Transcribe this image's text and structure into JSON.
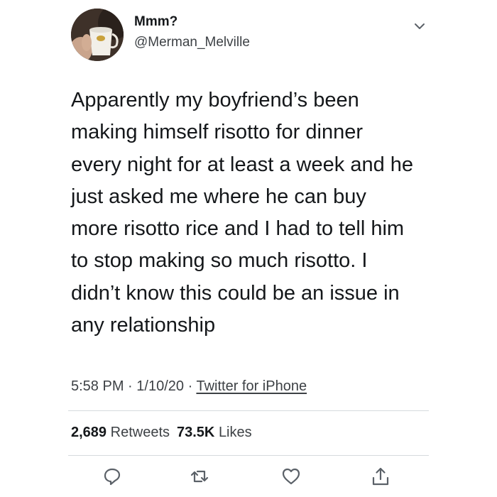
{
  "author": {
    "display_name": "Mmm?",
    "handle": "@Merman_Melville"
  },
  "tweet": {
    "text_lines": [
      "Apparently my boyfriend’s been",
      "making himself risotto for dinner",
      "every night for at least a week and he",
      "just asked me where he can buy",
      "more risotto rice and I had to tell him",
      "to stop making so much risotto. I",
      "didn’t know this could be an issue in",
      "any relationship"
    ],
    "time": "5:58 PM",
    "date": "1/10/20",
    "separator": "·",
    "source": "Twitter for iPhone"
  },
  "stats": {
    "retweets_count": "2,689",
    "retweets_label": "Retweets",
    "likes_count": "73.5K",
    "likes_label": "Likes"
  },
  "actions": {
    "reply_icon": "reply-icon",
    "retweet_icon": "retweet-icon",
    "like_icon": "heart-icon",
    "share_icon": "share-icon"
  },
  "colors": {
    "text_primary": "#14171a",
    "text_secondary": "#3d4145",
    "divider": "#d6dadd",
    "icon": "#5b6168"
  }
}
